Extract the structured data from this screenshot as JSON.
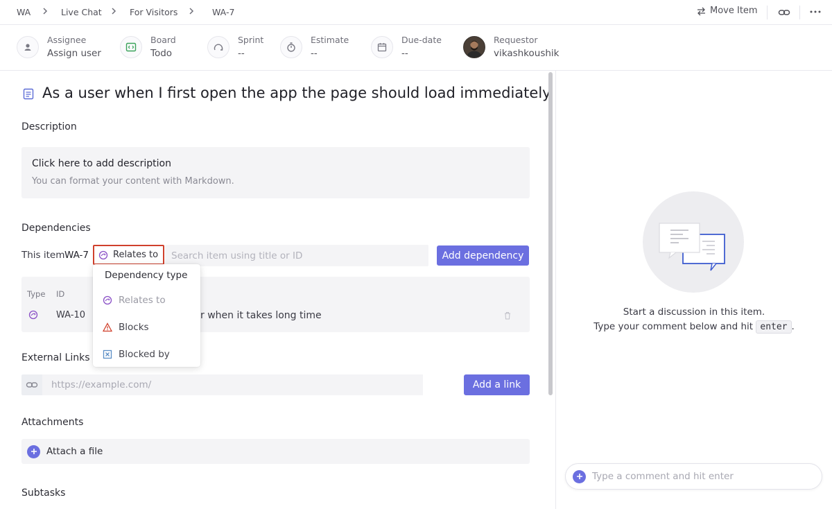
{
  "breadcrumb": [
    "WA",
    "Live Chat",
    "For Visitors",
    "WA-7"
  ],
  "top_actions": {
    "move_item": "Move Item"
  },
  "meta": {
    "assignee": {
      "label": "Assignee",
      "value": "Assign user"
    },
    "board": {
      "label": "Board",
      "value": "Todo"
    },
    "sprint": {
      "label": "Sprint",
      "value": "--"
    },
    "estimate": {
      "label": "Estimate",
      "value": "--"
    },
    "due_date": {
      "label": "Due-date",
      "value": "--"
    },
    "requestor": {
      "label": "Requestor",
      "value": "vikashkoushik"
    }
  },
  "item": {
    "title": "As a user when I first open the app the page should load immediately"
  },
  "description": {
    "heading": "Description",
    "placeholder_title": "Click here to add description",
    "placeholder_sub": "You can format your content with Markdown."
  },
  "dependencies": {
    "heading": "Dependencies",
    "this_item_prefix": "This item",
    "this_item_id": "WA-7",
    "type_button": "Relates to",
    "search_placeholder": "Search item using title or ID",
    "add_button": "Add dependency",
    "table_headers": {
      "type": "Type",
      "id": "ID"
    },
    "rows": [
      {
        "id": "WA-10",
        "title_partial": "r when it takes long time"
      }
    ],
    "dropdown": {
      "heading": "Dependency type",
      "options": [
        "Relates to",
        "Blocks",
        "Blocked by"
      ]
    }
  },
  "external_links": {
    "heading": "External Links",
    "placeholder": "https://example.com/",
    "add_button": "Add a link"
  },
  "attachments": {
    "heading": "Attachments",
    "attach_label": "Attach a file"
  },
  "subtasks": {
    "heading": "Subtasks"
  },
  "discussion": {
    "line1": "Start a discussion in this item.",
    "line2_prefix": "Type your comment below and hit",
    "key": "enter",
    "line2_suffix": ".",
    "comment_placeholder": "Type a comment and hit enter"
  },
  "colors": {
    "accent": "#6b6fe0",
    "highlight_border": "#d0402c"
  }
}
